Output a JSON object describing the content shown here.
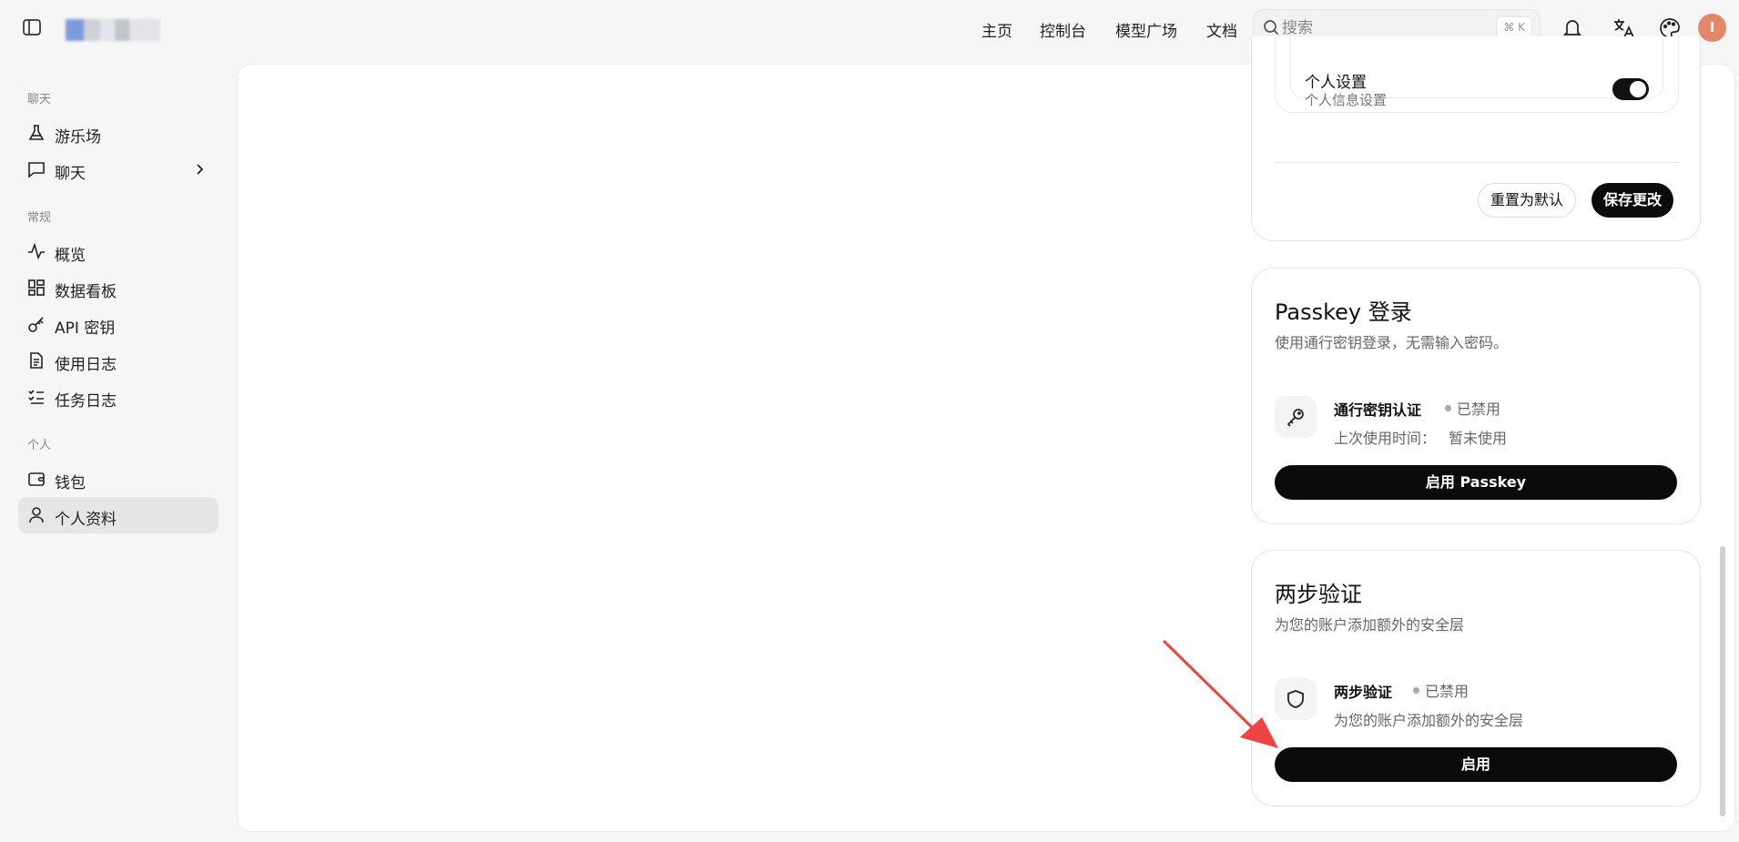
{
  "topbar": {
    "nav": [
      "主页",
      "控制台",
      "模型广场",
      "文档"
    ],
    "search_placeholder": "搜索",
    "shortcut": "⌘ K",
    "avatar_initial": "I"
  },
  "sidebar": {
    "sections": [
      {
        "title": "聊天",
        "items": [
          {
            "label": "游乐场"
          },
          {
            "label": "聊天"
          }
        ]
      },
      {
        "title": "常规",
        "items": [
          {
            "label": "概览"
          },
          {
            "label": "数据看板"
          },
          {
            "label": "API 密钥"
          },
          {
            "label": "使用日志"
          },
          {
            "label": "任务日志"
          }
        ]
      },
      {
        "title": "个人",
        "items": [
          {
            "label": "钱包"
          },
          {
            "label": "个人资料"
          }
        ]
      }
    ],
    "active": "个人资料"
  },
  "settings_card": {
    "setting_title": "个人设置",
    "setting_sub": "个人信息设置",
    "toggle_on": true,
    "reset_label": "重置为默认",
    "save_label": "保存更改"
  },
  "passkey_card": {
    "title": "Passkey 登录",
    "desc": "使用通行密钥登录，无需输入密码。",
    "item_title": "通行密钥认证",
    "status": "已禁用",
    "last_used_label": "上次使用时间：",
    "last_used_value": "暂未使用",
    "button": "启用 Passkey"
  },
  "twofa_card": {
    "title": "两步验证",
    "desc": "为您的账户添加额外的安全层",
    "item_title": "两步验证",
    "status": "已禁用",
    "item_sub": "为您的账户添加额外的安全层",
    "button": "启用"
  },
  "colors": {
    "accent": "#0b0b0b",
    "avatar": "#e3876a",
    "arrow": "#ef4444"
  }
}
